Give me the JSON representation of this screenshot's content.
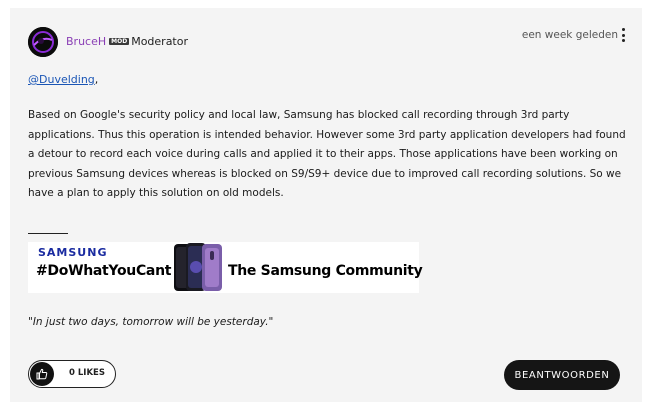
{
  "post": {
    "author": {
      "username": "BruceH",
      "badge": "MOD",
      "role": "Moderator"
    },
    "timestamp": "een week geleden",
    "mention": "@Duvelding",
    "mention_suffix": ",",
    "body": "Based on Google's security policy and local law, Samsung has blocked call recording through 3rd party applications. Thus this operation is intended behavior. However some 3rd party application developers had found a detour to record each voice during calls and applied it to their apps. Those applications have been working on previous Samsung devices whereas is blocked on S9/S9+ device due to improved call recording solutions. So we have a plan to apply this solution on old models.",
    "signature": {
      "brand": "SAMSUNG",
      "hashtag": "#DoWhatYouCant",
      "community": "The Samsung Community",
      "quote": "\"In just two days, tomorrow will be yesterday.\""
    }
  },
  "actions": {
    "likes_label": "0 LIKES",
    "reply_label": "BEANTWOORDEN"
  },
  "colors": {
    "card_bg": "#f4f4f4",
    "username": "#8a3fb5",
    "link": "#1a55b5",
    "samsung_blue": "#1a2ba0",
    "button_dark": "#151515"
  }
}
